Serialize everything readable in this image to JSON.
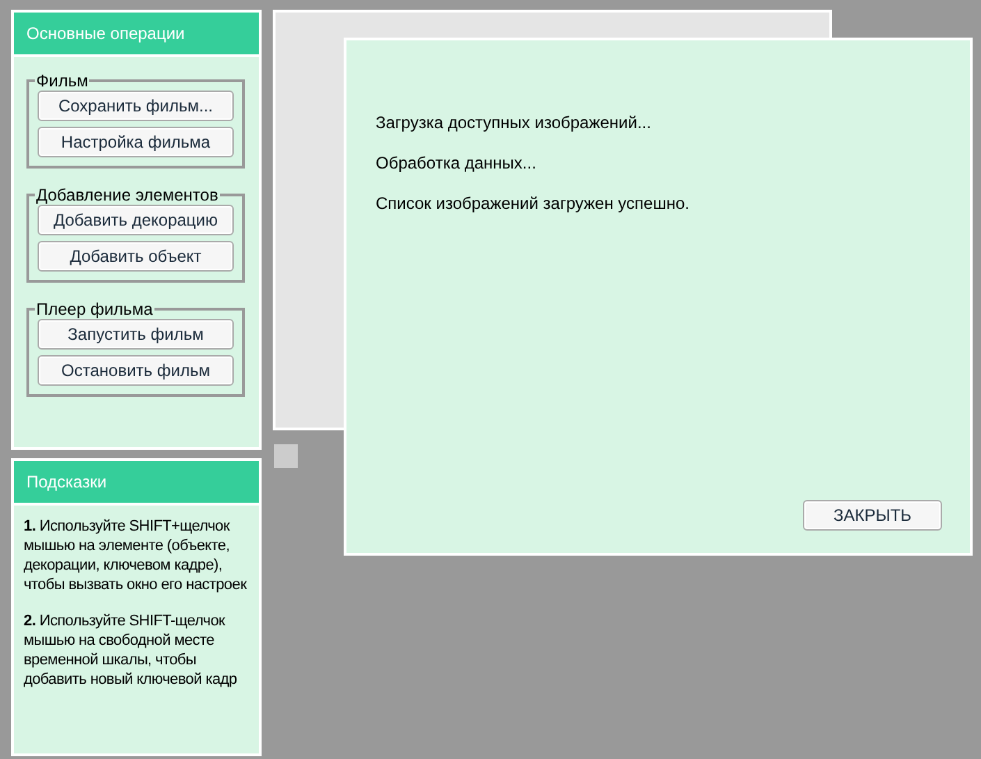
{
  "operations_panel": {
    "title": "Основные операции",
    "groups": [
      {
        "legend": "Фильм",
        "buttons": [
          "Сохранить фильм...",
          "Настройка фильма"
        ]
      },
      {
        "legend": "Добавление элементов",
        "buttons": [
          "Добавить декорацию",
          "Добавить объект"
        ]
      },
      {
        "legend": "Плеер фильма",
        "buttons": [
          "Запустить фильм",
          "Остановить фильм"
        ]
      }
    ]
  },
  "hints_panel": {
    "title": "Подсказки",
    "hints": [
      "**1.** Используйте SHIFT+щелчок мышью на элементе (объекте, декорации, ключевом кадре), чтобы вызвать окно его настроек",
      "**2.** Используйте SHIFT-щелчок мышью на свободной месте временной шкалы, чтобы добавить новый ключевой кадр"
    ]
  },
  "dialog": {
    "messages": [
      "Загрузка доступных изображений...",
      "Обработка данных...",
      "Список изображений загружен успешно."
    ],
    "close_button": "ЗАКРЫТЬ"
  }
}
